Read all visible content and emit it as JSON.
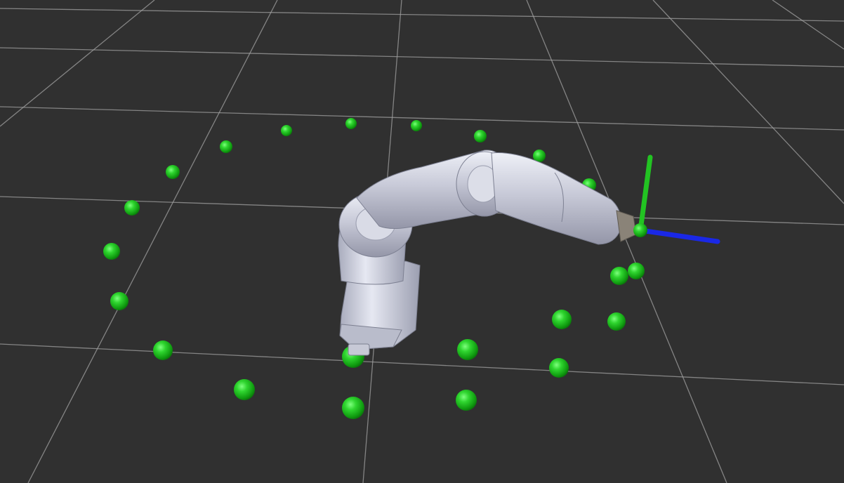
{
  "viewport": {
    "background_color": "#303030",
    "grid_color": "#a0a0a0",
    "target_marker_color": "#19b819",
    "robot_color": "#c9ccda",
    "axis_colors": {
      "x": "#e01010",
      "y": "#22c322",
      "z": "#1a28e6"
    },
    "icons": {
      "grid": "floor-grid",
      "robot": "robot-arm-model",
      "markers": "target-sphere",
      "frame": "tf-axes"
    }
  }
}
